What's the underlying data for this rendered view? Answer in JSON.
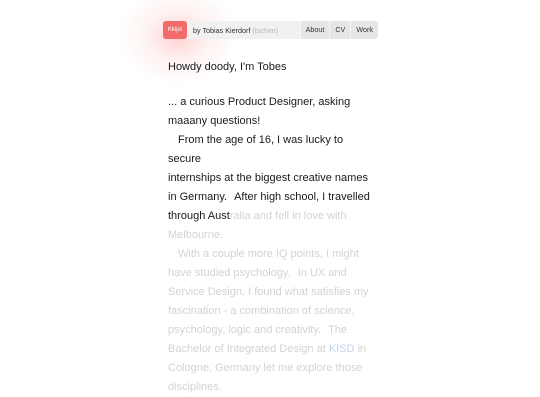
{
  "header": {
    "logo_text": "Kkijel",
    "byline_prefix": "by Tobias Kierdorf",
    "pronunciation": "(tschim)",
    "nav": [
      "About",
      "CV",
      "Work"
    ]
  },
  "intro": {
    "greeting": "Howdy doody, I'm Tobes",
    "lines": [
      "... a curious Product Designer, asking",
      "maaany questions!",
      "From the age of 16, I was lucky to secure",
      "internships at the biggest creative names",
      "in Germany.",
      "After high school, I travelled",
      "through Aust",
      "ralia and fell in love with",
      "Melbourne.",
      "With a couple more IQ points, I might",
      "have studied psychology.",
      "In UX and",
      "Service Design, I found what satisfies my",
      "fascination - a combination of science,",
      "psychology, logic and creativity.",
      "The",
      "Bachelor of Integrated Design at ",
      "KISD",
      " in",
      "Cologne, Germany let me explore those",
      "disciplines."
    ]
  },
  "colors": {
    "accent": "#f26b6b",
    "text": "#1a1a1a",
    "faded_text": "#d3d3d3",
    "nav_bg": "#e6e6e6"
  }
}
